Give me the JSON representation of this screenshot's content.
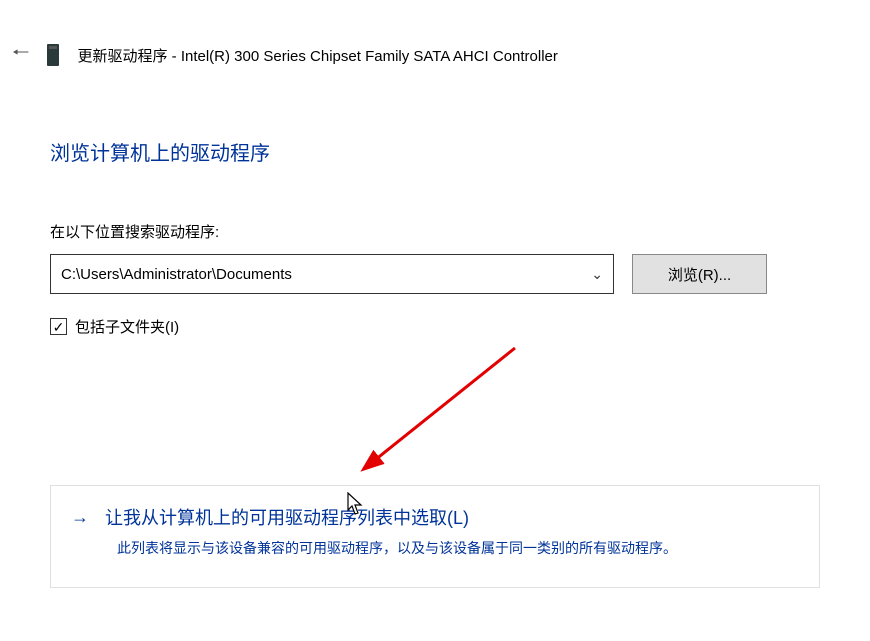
{
  "header": {
    "title": "更新驱动程序 - Intel(R) 300 Series Chipset Family SATA AHCI Controller"
  },
  "page": {
    "heading": "浏览计算机上的驱动程序",
    "search_label": "在以下位置搜索驱动程序:",
    "path_value": "C:\\Users\\Administrator\\Documents",
    "browse_button": "浏览(R)...",
    "include_subfolders_label": "包括子文件夹(I)",
    "include_subfolders_checked": true
  },
  "option": {
    "title": "让我从计算机上的可用驱动程序列表中选取(L)",
    "description": "此列表将显示与该设备兼容的可用驱动程序，以及与该设备属于同一类别的所有驱动程序。"
  }
}
